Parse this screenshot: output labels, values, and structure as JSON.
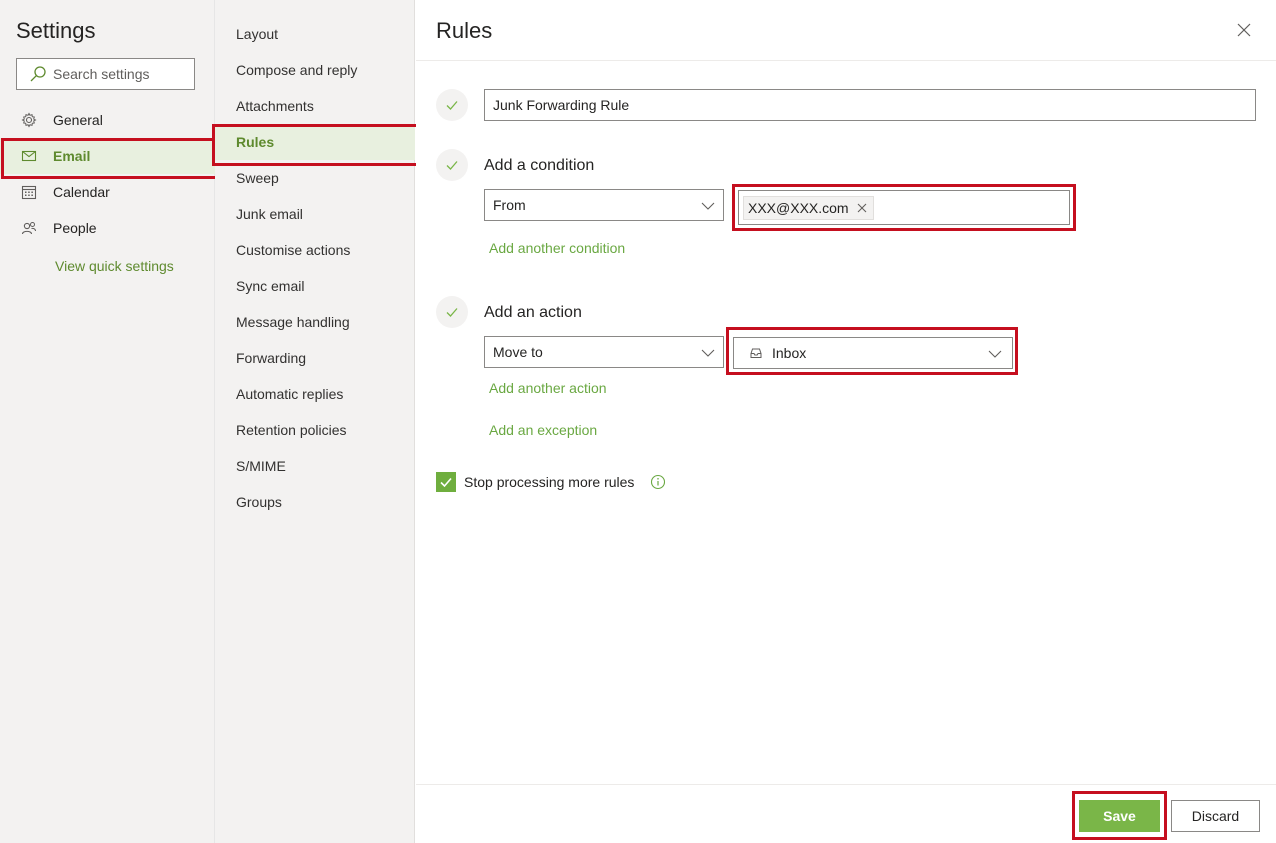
{
  "settings": {
    "title": "Settings",
    "search_placeholder": "Search settings",
    "nav": [
      {
        "label": "General",
        "icon": "gear-icon"
      },
      {
        "label": "Email",
        "icon": "mail-icon"
      },
      {
        "label": "Calendar",
        "icon": "calendar-icon"
      },
      {
        "label": "People",
        "icon": "people-icon"
      }
    ],
    "active_nav": "Email",
    "quick_settings_link": "View quick settings"
  },
  "email_nav": {
    "items": [
      "Layout",
      "Compose and reply",
      "Attachments",
      "Rules",
      "Sweep",
      "Junk email",
      "Customise actions",
      "Sync email",
      "Message handling",
      "Forwarding",
      "Automatic replies",
      "Retention policies",
      "S/MIME",
      "Groups"
    ],
    "active": "Rules"
  },
  "rules": {
    "title": "Rules",
    "rule_name": "Junk Forwarding Rule",
    "condition": {
      "label": "Add a condition",
      "type": "From",
      "recipient": "XXX@XXX.com",
      "add_another": "Add another condition"
    },
    "action": {
      "label": "Add an action",
      "type": "Move to",
      "folder": "Inbox",
      "add_another": "Add another action"
    },
    "add_exception": "Add an exception",
    "stop_processing": {
      "label": "Stop processing more rules",
      "checked": true
    },
    "save_label": "Save",
    "discard_label": "Discard"
  },
  "colors": {
    "accent": "#5e8a2e",
    "link": "#6aa842",
    "save_button": "#7ab648",
    "highlight_border": "#c50f1f"
  }
}
